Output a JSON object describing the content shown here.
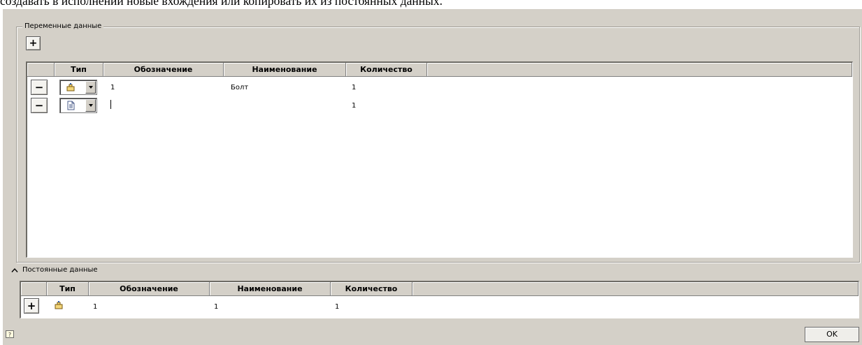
{
  "caption": "создавать в исполнении новые вхождения или копировать их из постоянных данных.",
  "variable_section": {
    "title": "Переменные данные",
    "add_label": "+",
    "remove_label": "−",
    "columns": [
      "Тип",
      "Обозначение",
      "Наименование",
      "Количество"
    ],
    "rows": [
      {
        "type_icon": "part-icon",
        "designation": "1",
        "name": "Болт",
        "quantity": "1"
      },
      {
        "type_icon": "document-icon",
        "designation": "",
        "name": "",
        "quantity": "1"
      }
    ]
  },
  "constant_section": {
    "title": "Постоянные данные",
    "add_label": "+",
    "columns": [
      "Тип",
      "Обозначение",
      "Наименование",
      "Количество"
    ],
    "rows": [
      {
        "type_icon": "part-icon",
        "designation": "1",
        "name": "1",
        "quantity": "1"
      }
    ]
  },
  "ok_label": "OK"
}
